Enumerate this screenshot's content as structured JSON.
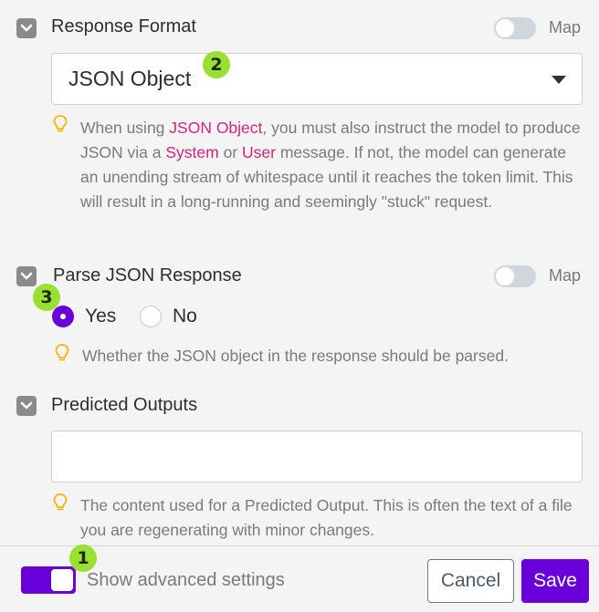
{
  "response_format": {
    "label": "Response Format",
    "map_label": "Map",
    "selected_value": "JSON Object",
    "hint": {
      "t1": "When using ",
      "h1": "JSON Object",
      "t2": ", you must also instruct the model to produce JSON via a ",
      "h2": "System",
      "t3": " or ",
      "h3": "User",
      "t4": " message. If not, the model can generate an unending stream of whitespace until it reaches the token limit. This will result in a long-running and seemingly \"stuck\" request."
    }
  },
  "parse_json": {
    "label": "Parse JSON Response",
    "map_label": "Map",
    "options": [
      {
        "label": "Yes",
        "selected": true
      },
      {
        "label": "No",
        "selected": false
      }
    ],
    "hint": "Whether the JSON object in the response should be parsed."
  },
  "predicted_outputs": {
    "label": "Predicted Outputs",
    "value": "",
    "hint": "The content used for a Predicted Output. This is often the text of a file you are regenerating with minor changes."
  },
  "footer": {
    "advanced_label": "Show advanced settings",
    "advanced_enabled": true,
    "cancel_label": "Cancel",
    "save_label": "Save"
  },
  "badges": {
    "b1": "1",
    "b2": "2",
    "b3": "3"
  },
  "colors": {
    "accent": "#6a00d9",
    "highlight": "#d4237a",
    "badge": "#9ae033"
  },
  "icons": {
    "collapse": "chevron-down-icon",
    "hint": "lightbulb-icon",
    "dropdown": "caret-down-icon"
  }
}
